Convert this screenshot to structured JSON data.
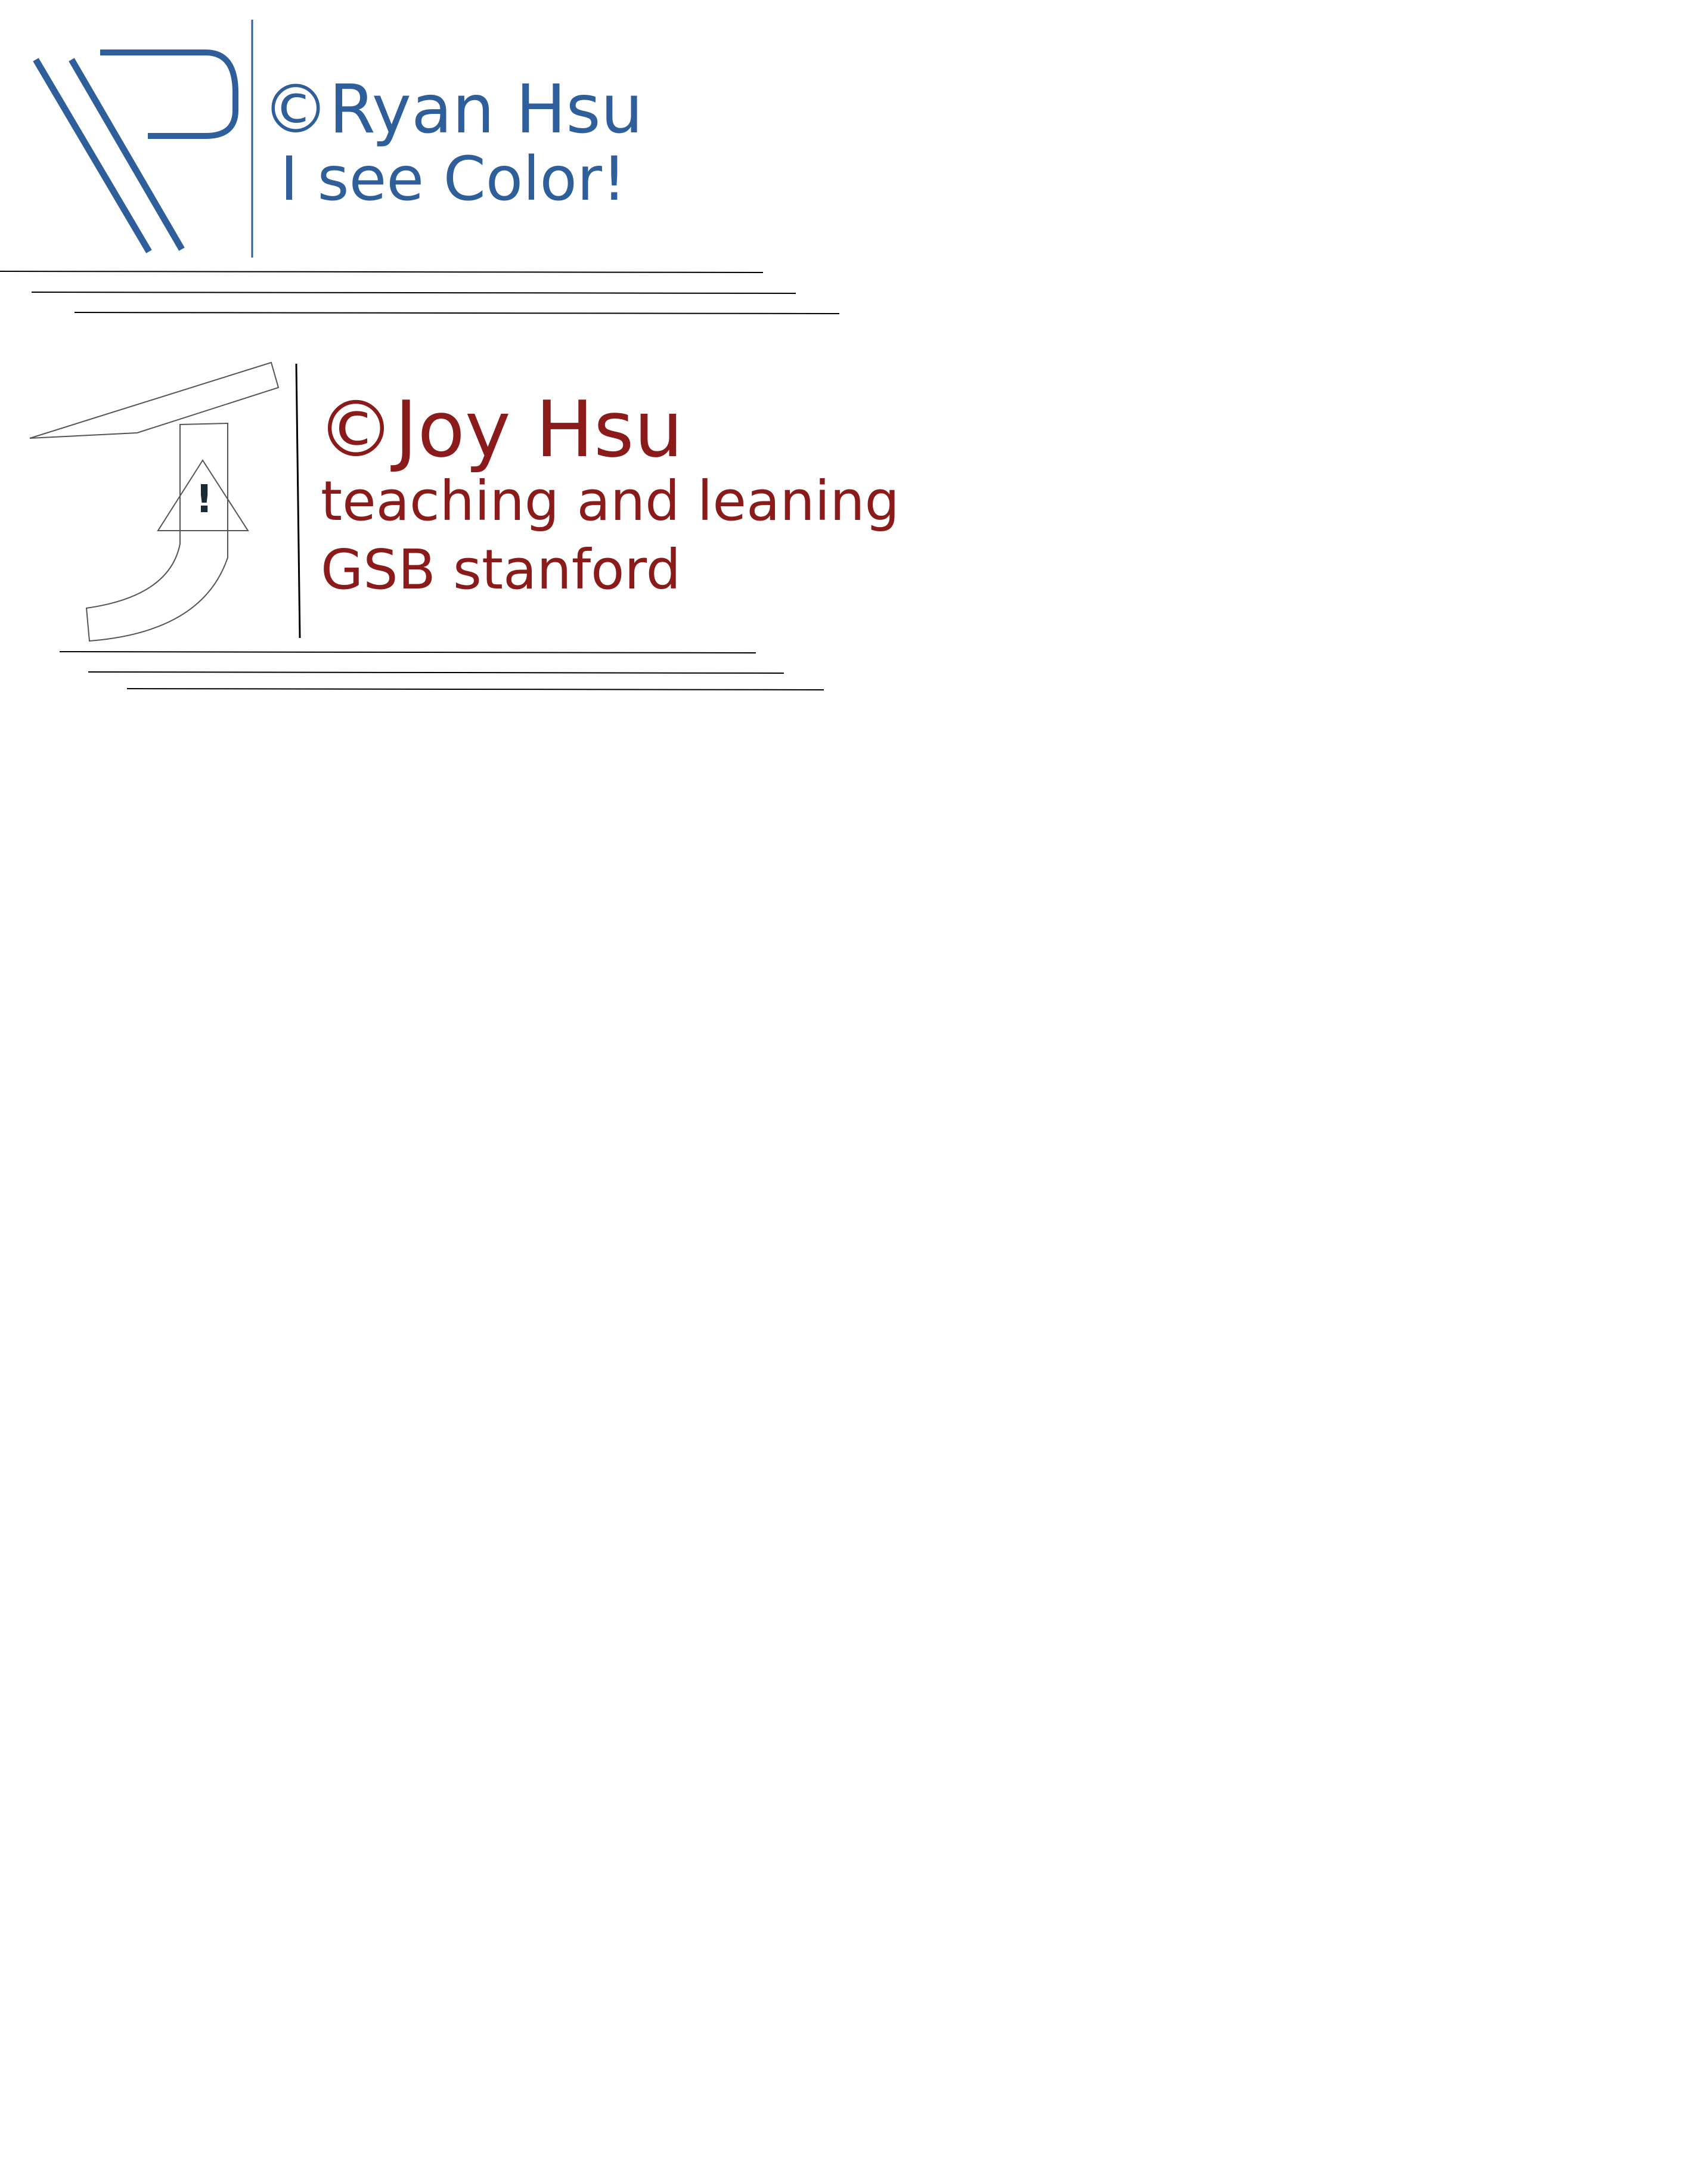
{
  "ryan_card": {
    "name": "©Ryan Hsu",
    "tagline": "I see Color!",
    "color": "#2f5f9a"
  },
  "joy_card": {
    "name": "©Joy Hsu",
    "line1": "teaching and leaning",
    "line2": "GSB stanford",
    "logo_mark": "!",
    "color": "#8b1a1a"
  }
}
